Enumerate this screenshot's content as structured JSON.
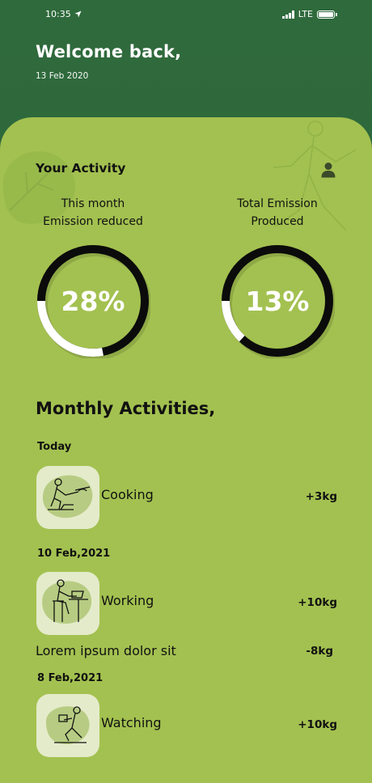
{
  "status_bar": {
    "time": "10:35",
    "network": "LTE"
  },
  "header": {
    "title": "Welcome back,",
    "date": "13 Feb 2020"
  },
  "activity": {
    "title": "Your Activity",
    "stats": [
      {
        "label_line1": "This month",
        "label_line2": "Emission reduced",
        "percent_text": "28%",
        "fill_fraction": 0.28
      },
      {
        "label_line1": "Total Emission",
        "label_line2": "Produced",
        "percent_text": "13%",
        "fill_fraction": 0.13
      }
    ]
  },
  "monthly": {
    "title": "Monthly Activities,",
    "groups": [
      {
        "date": "Today",
        "items": [
          {
            "name": "Cooking",
            "value": "+3kg",
            "icon": "cooking-illustration"
          }
        ]
      },
      {
        "date": "10 Feb,2021",
        "items": [
          {
            "name": "Working",
            "value": "+10kg",
            "icon": "working-illustration"
          },
          {
            "name": "Lorem ipsum dolor sit",
            "value": "-8kg"
          }
        ]
      },
      {
        "date": "8 Feb,2021",
        "items": [
          {
            "name": "Watching",
            "value": "+10kg",
            "icon": "watching-illustration"
          }
        ]
      }
    ]
  },
  "colors": {
    "header_bg": "#2f6a3c",
    "card_bg": "#a3c150",
    "ring_dark": "#0b0b0b",
    "ring_light": "#ffffff",
    "thumb_bg": "#e4ebca"
  }
}
